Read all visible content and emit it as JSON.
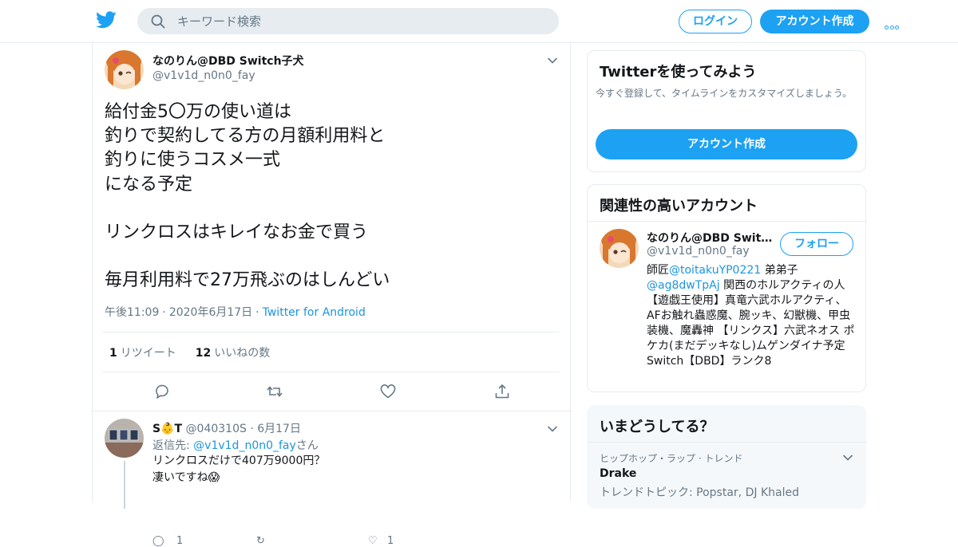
{
  "colors": {
    "brand": "#1da1f2",
    "link": "#1b95e0",
    "secondary_text": "#657786",
    "border": "#e6ecf0"
  },
  "header": {
    "logo_icon": "twitter-bird-icon",
    "search_placeholder": "キーワード検索",
    "login_label": "ログイン",
    "signup_label": "アカウント作成",
    "more_icon": "more-dots-icon"
  },
  "tweet": {
    "display_name": "なのりん@DBD Switch子犬",
    "handle": "@v1v1d_n0n0_fay",
    "text": "給付金5〇万の使い道は\n釣りで契約してる方の月額利用料と\n釣りに使うコスメ一式\nになる予定\n\nリンクロスはキレイなお金で買う\n\n毎月利用料で27万飛ぶのはしんどい",
    "time": "午後11:09",
    "date": "2020年6月17日",
    "source": "Twitter for Android",
    "retweet_count": "1",
    "retweet_label": "リツイート",
    "like_count": "12",
    "like_label": "いいねの数"
  },
  "reply": {
    "display_name": "S👶T",
    "handle": "@040310S",
    "date": "6月17日",
    "replying_prefix": "返信先: ",
    "replying_to": "@v1v1d_n0n0_fay",
    "replying_suffix": "さん",
    "text": "リンクロスだけで407万9000円？\n凄いですね😱",
    "reply_count": "1",
    "like_count": "1"
  },
  "sidebar": {
    "signup_card": {
      "title": "Twitterを使ってみよう",
      "description": "今すぐ登録して、タイムラインをカスタマイズしましょう。",
      "button": "アカウント作成"
    },
    "related_card": {
      "title": "関連性の高いアカウント",
      "display_name": "なのりん@DBD Switch子犬",
      "handle": "@v1v1d_n0n0_fay",
      "follow_label": "フォロー",
      "bio_prefix": "師匠",
      "bio_link1": "@toitakuYP0221",
      "bio_mid": " 弟弟子",
      "bio_link2": "@ag8dwTpAj",
      "bio_rest": " 関西のホルアクティの人【遊戯王使用】真竜六武ホルアクティ、AFお触れ蟲惑魔、腕ッキ、幻獣機、甲虫装機、魔轟神 【リンクス】六武ネオス ポケカ(まだデッキなし)ムゲンダイナ予定 Switch【DBD】ランク8"
    },
    "trends_card": {
      "title": "いまどうしてる？",
      "context": "ヒップホップ・ラップ · トレンド",
      "trend": "Drake",
      "subtitle": "トレンドトピック: Popstar, DJ Khaled"
    }
  }
}
